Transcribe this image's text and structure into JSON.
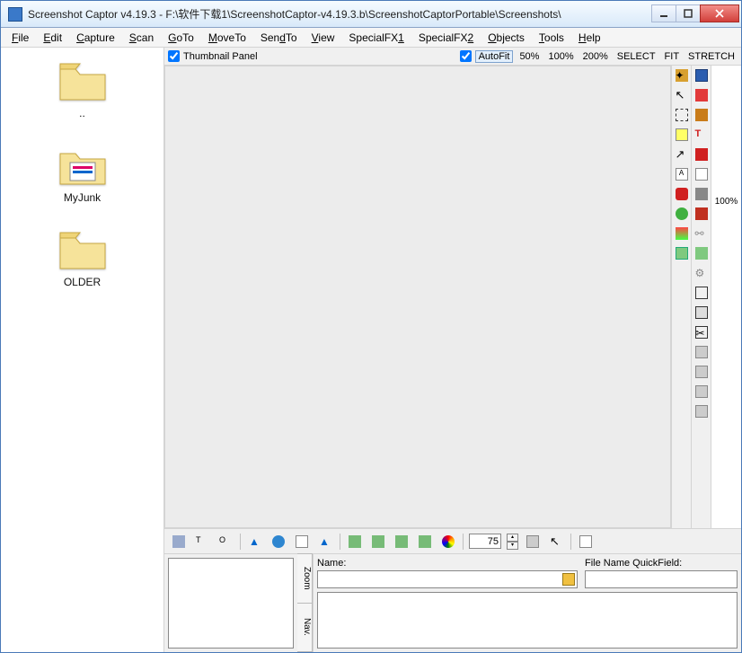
{
  "window": {
    "title": "Screenshot Captor v4.19.3 - F:\\软件下载1\\ScreenshotCaptor-v4.19.3.b\\ScreenshotCaptorPortable\\Screenshots\\"
  },
  "menu": [
    "File",
    "Edit",
    "Capture",
    "Scan",
    "GoTo",
    "MoveTo",
    "SendTo",
    "View",
    "SpecialFX1",
    "SpecialFX2",
    "Objects",
    "Tools",
    "Help"
  ],
  "menu_accel": [
    "F",
    "E",
    "C",
    "S",
    "G",
    "M",
    "S",
    "V",
    "1",
    "2",
    "O",
    "T",
    "H"
  ],
  "sidebar": {
    "items": [
      {
        "label": ".."
      },
      {
        "label": "MyJunk"
      },
      {
        "label": "OLDER"
      }
    ]
  },
  "canvas_bar": {
    "thumb_label": "Thumbnail Panel",
    "autofit": "AutoFit",
    "zooms": [
      "50%",
      "100%",
      "200%",
      "SELECT",
      "FIT",
      "STRETCH"
    ]
  },
  "right_panel": {
    "zoom": "100%"
  },
  "bottom_bar": {
    "value": "75"
  },
  "lower": {
    "tabs": [
      "Zoom",
      "Nav."
    ],
    "name_label": "Name:",
    "qf_label": "File Name QuickField:"
  },
  "tool_icons_left": [
    "wand-icon",
    "cursor-icon",
    "selection-icon",
    "highlight-icon",
    "arrow-icon",
    "text-frame-icon",
    "brush-icon",
    "shapes-icon",
    "color-icon",
    "image-icon"
  ],
  "tool_icons_right": [
    "save-icon",
    "copy-star-icon",
    "edit-pencil-icon",
    "text-tool-icon",
    "remove-icon",
    "sheet-icon",
    "print-icon",
    "toolbox-icon",
    "link-icon",
    "image-export-icon",
    "gear-icon",
    "fit-icon",
    "maximize-icon",
    "crop-icon",
    "panel1-icon",
    "panel2-icon",
    "panel3-icon",
    "panel4-icon"
  ],
  "bottom_icons": [
    "scanner-icon",
    "text1-icon",
    "text2-icon",
    "rotate-icon",
    "globe-icon",
    "doc-icon",
    "flip-icon",
    "crop1-icon",
    "crop2-icon",
    "crop3-icon",
    "crop4-icon",
    "rainbow-icon"
  ]
}
